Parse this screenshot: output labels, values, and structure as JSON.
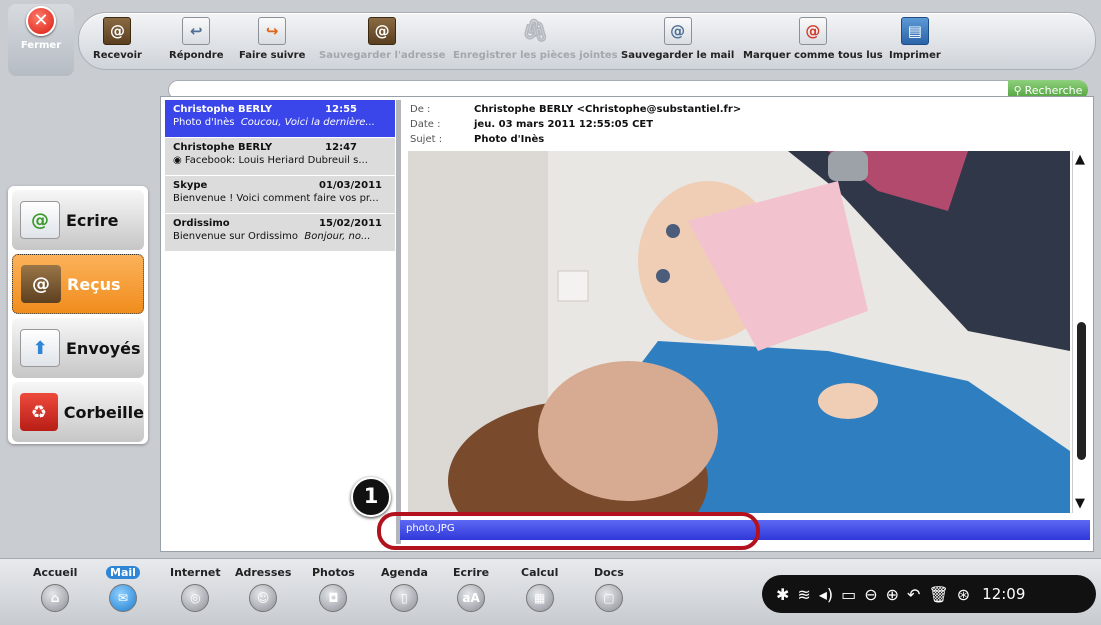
{
  "toolbar": {
    "close": "Fermer",
    "receive": "Recevoir",
    "reply": "Répondre",
    "forward": "Faire suivre",
    "save_address": "Sauvegarder l'adresse",
    "save_attachments": "Enregistrer les pièces jointes",
    "save_mail": "Sauvegarder le mail",
    "mark_all_read": "Marquer comme tous lus",
    "print": "Imprimer"
  },
  "search": {
    "button": "Recherche"
  },
  "folders": [
    {
      "label": "Ecrire"
    },
    {
      "label": "Reçus"
    },
    {
      "label": "Envoyés"
    },
    {
      "label": "Corbeille"
    }
  ],
  "messages": [
    {
      "sender": "Christophe BERLY",
      "time": "12:55",
      "subject": "Photo d'Inès",
      "preview": "Coucou, Voici la dernière..."
    },
    {
      "sender": "Christophe BERLY",
      "time": "12:47",
      "subject": "Facebook: Louis Heriard Dubreuil s...",
      "preview": ""
    },
    {
      "sender": "Skype",
      "time": "01/03/2011",
      "subject": "Bienvenue ! Voici comment faire vos pr...",
      "preview": ""
    },
    {
      "sender": "Ordissimo",
      "time": "15/02/2011",
      "subject": "Bienvenue sur Ordissimo",
      "preview": "Bonjour, no..."
    }
  ],
  "header": {
    "from_label": "De :",
    "from": "Christophe BERLY <Christophe@substantiel.fr>",
    "date_label": "Date :",
    "date": "jeu. 03 mars 2011 12:55:05 CET",
    "subject_label": "Sujet :",
    "subject": "Photo d'Inès"
  },
  "attachment": {
    "filename": "photo.JPG"
  },
  "callout": "1",
  "dock": [
    {
      "label": "Accueil"
    },
    {
      "label": "Mail"
    },
    {
      "label": "Internet"
    },
    {
      "label": "Adresses"
    },
    {
      "label": "Photos"
    },
    {
      "label": "Agenda"
    },
    {
      "label": "Ecrire"
    },
    {
      "label": "Calcul"
    },
    {
      "label": "Docs"
    }
  ],
  "tray": {
    "clock": "12:09"
  },
  "colors": {
    "selected": "#3a45ea",
    "accent_orange": "#f08d1d",
    "highlight_ring": "#b2121e"
  }
}
